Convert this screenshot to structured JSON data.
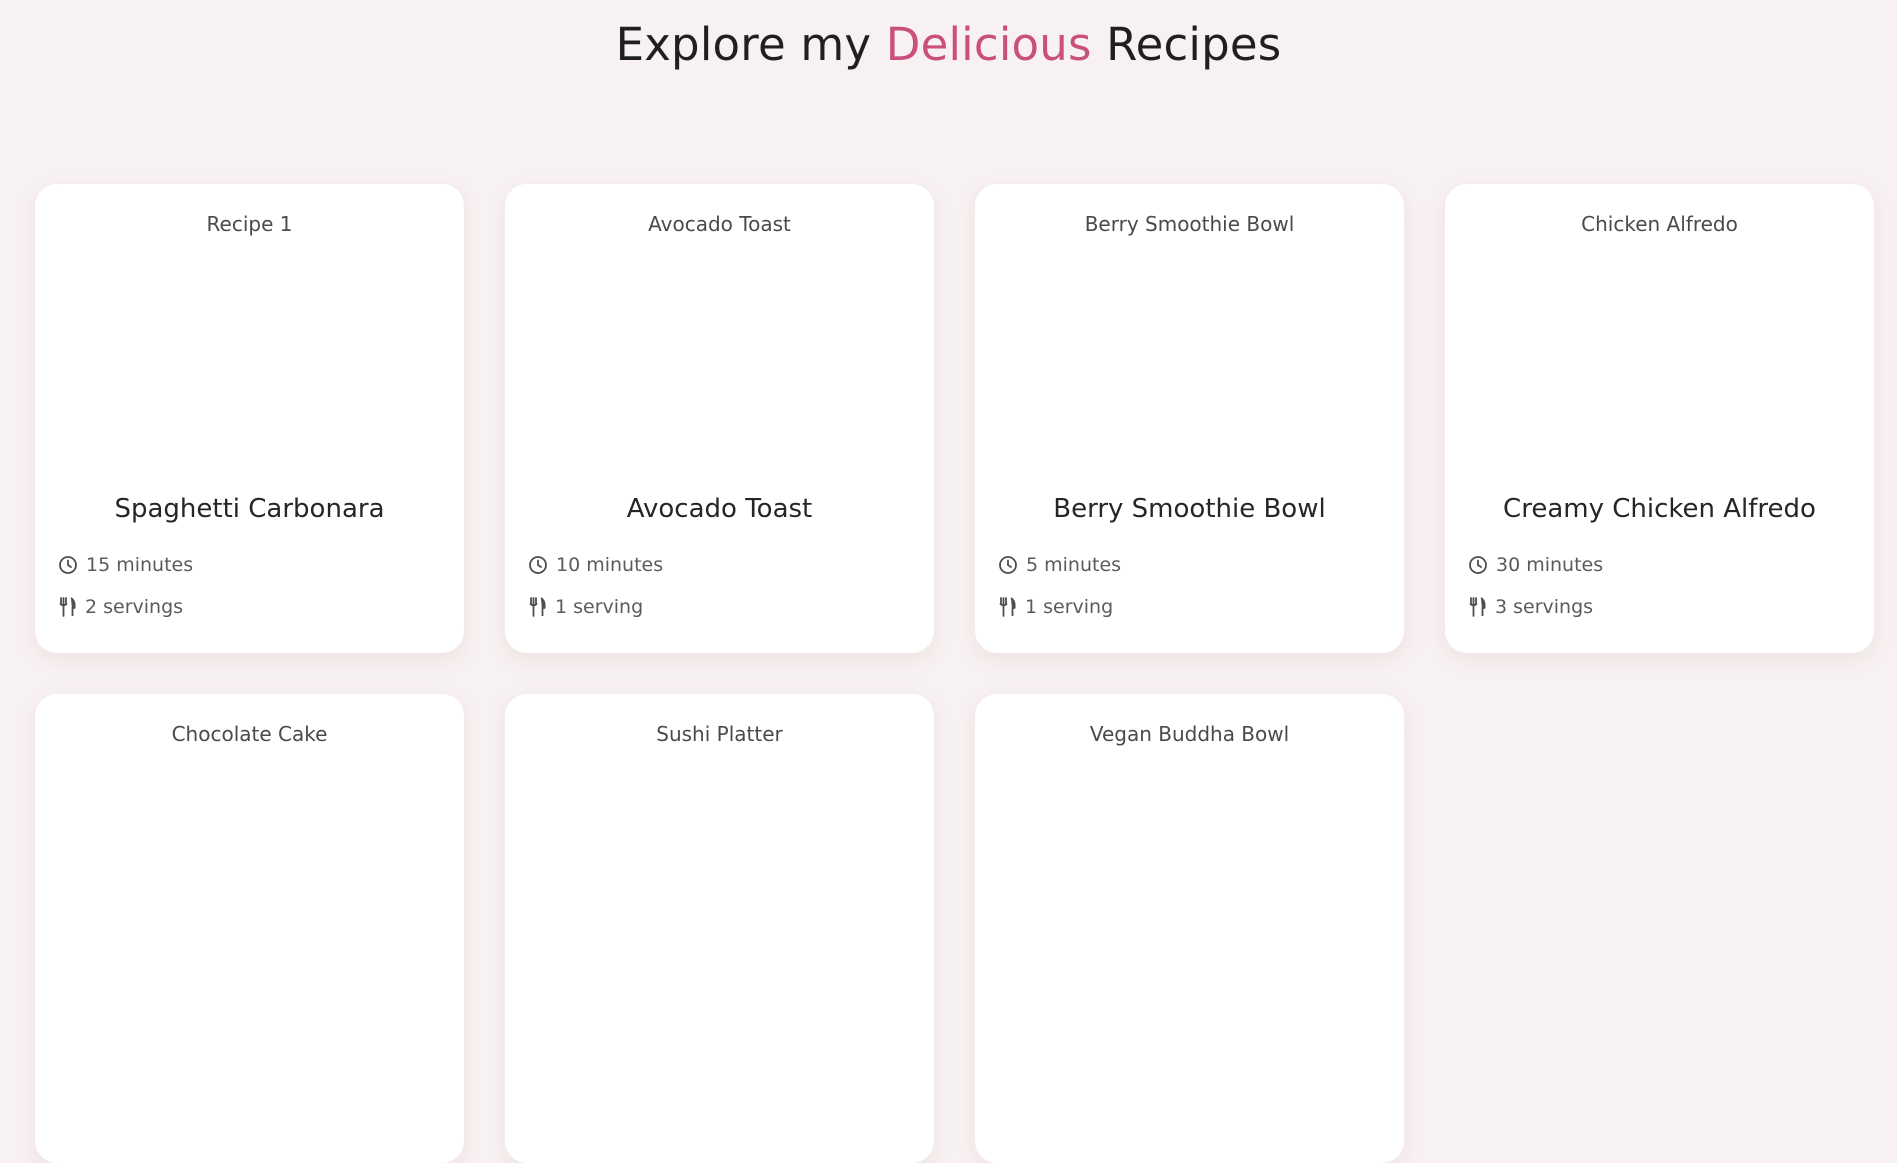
{
  "header": {
    "title_prefix": "Explore my ",
    "title_accent": "Delicious",
    "title_suffix": " Recipes",
    "accent_color": "#c9507c"
  },
  "recipes": [
    {
      "image_alt": "Recipe 1",
      "title": "Spaghetti Carbonara",
      "time": "15 minutes",
      "servings": "2 servings"
    },
    {
      "image_alt": "Avocado Toast",
      "title": "Avocado Toast",
      "time": "10 minutes",
      "servings": "1 serving"
    },
    {
      "image_alt": "Berry Smoothie Bowl",
      "title": "Berry Smoothie Bowl",
      "time": "5 minutes",
      "servings": "1 serving"
    },
    {
      "image_alt": "Chicken Alfredo",
      "title": "Creamy Chicken Alfredo",
      "time": "30 minutes",
      "servings": "3 servings"
    },
    {
      "image_alt": "Chocolate Cake"
    },
    {
      "image_alt": "Sushi Platter"
    },
    {
      "image_alt": "Vegan Buddha Bowl"
    }
  ],
  "icons": {
    "time": "clock-icon",
    "servings": "utensils-icon"
  }
}
